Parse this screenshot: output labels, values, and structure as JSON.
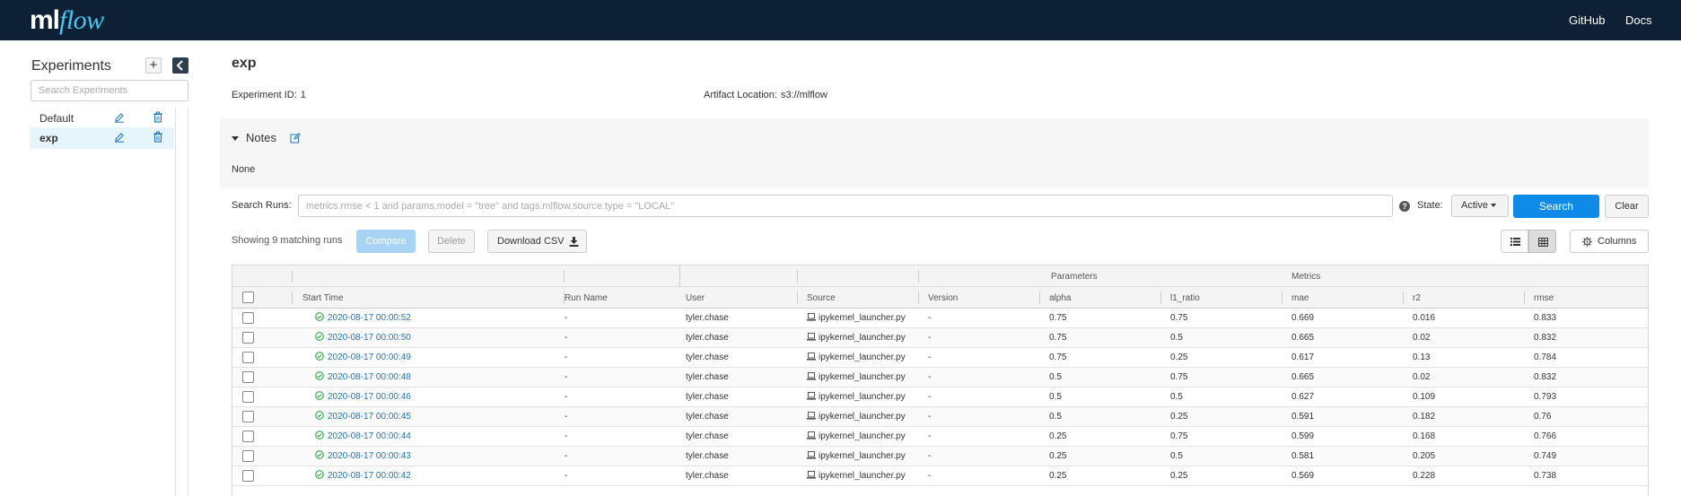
{
  "header": {
    "logo_ml": "ml",
    "logo_flow": "flow",
    "links": [
      "GitHub",
      "Docs"
    ]
  },
  "sidebar": {
    "title": "Experiments",
    "add_label": "+",
    "search_placeholder": "Search Experiments",
    "items": [
      {
        "label": "Default",
        "active": false
      },
      {
        "label": "exp",
        "active": true
      }
    ]
  },
  "experiment": {
    "name": "exp",
    "id_label": "Experiment ID:",
    "id_value": "1",
    "artifact_label": "Artifact Location:",
    "artifact_value": "s3://mlflow"
  },
  "notes": {
    "title": "Notes",
    "content": "None"
  },
  "search": {
    "label": "Search Runs:",
    "placeholder": "metrics.rmse < 1 and params.model = \"tree\" and tags.mlflow.source.type = \"LOCAL\"",
    "help": "?",
    "state_label": "State:",
    "state_value": "Active",
    "search_button": "Search",
    "clear_button": "Clear"
  },
  "toolbar": {
    "showing": "Showing 9 matching runs",
    "compare": "Compare",
    "delete": "Delete",
    "download_csv": "Download CSV",
    "columns": "Columns"
  },
  "table": {
    "group_headers": {
      "parameters": "Parameters",
      "metrics": "Metrics"
    },
    "columns": [
      "Start Time",
      "Run Name",
      "User",
      "Source",
      "Version",
      "alpha",
      "l1_ratio",
      "mae",
      "r2",
      "rmse"
    ],
    "rows": [
      {
        "start": "2020-08-17 00:00:52",
        "run_name": "-",
        "user": "tyler.chase",
        "source": "ipykernel_launcher.py",
        "version": "-",
        "alpha": "0.75",
        "l1_ratio": "0.75",
        "mae": "0.669",
        "r2": "0.016",
        "rmse": "0.833"
      },
      {
        "start": "2020-08-17 00:00:50",
        "run_name": "-",
        "user": "tyler.chase",
        "source": "ipykernel_launcher.py",
        "version": "-",
        "alpha": "0.75",
        "l1_ratio": "0.5",
        "mae": "0.665",
        "r2": "0.02",
        "rmse": "0.832"
      },
      {
        "start": "2020-08-17 00:00:49",
        "run_name": "-",
        "user": "tyler.chase",
        "source": "ipykernel_launcher.py",
        "version": "-",
        "alpha": "0.75",
        "l1_ratio": "0.25",
        "mae": "0.617",
        "r2": "0.13",
        "rmse": "0.784"
      },
      {
        "start": "2020-08-17 00:00:48",
        "run_name": "-",
        "user": "tyler.chase",
        "source": "ipykernel_launcher.py",
        "version": "-",
        "alpha": "0.5",
        "l1_ratio": "0.75",
        "mae": "0.665",
        "r2": "0.02",
        "rmse": "0.832"
      },
      {
        "start": "2020-08-17 00:00:46",
        "run_name": "-",
        "user": "tyler.chase",
        "source": "ipykernel_launcher.py",
        "version": "-",
        "alpha": "0.5",
        "l1_ratio": "0.5",
        "mae": "0.627",
        "r2": "0.109",
        "rmse": "0.793"
      },
      {
        "start": "2020-08-17 00:00:45",
        "run_name": "-",
        "user": "tyler.chase",
        "source": "ipykernel_launcher.py",
        "version": "-",
        "alpha": "0.5",
        "l1_ratio": "0.25",
        "mae": "0.591",
        "r2": "0.182",
        "rmse": "0.76"
      },
      {
        "start": "2020-08-17 00:00:44",
        "run_name": "-",
        "user": "tyler.chase",
        "source": "ipykernel_launcher.py",
        "version": "-",
        "alpha": "0.25",
        "l1_ratio": "0.75",
        "mae": "0.599",
        "r2": "0.168",
        "rmse": "0.766"
      },
      {
        "start": "2020-08-17 00:00:43",
        "run_name": "-",
        "user": "tyler.chase",
        "source": "ipykernel_launcher.py",
        "version": "-",
        "alpha": "0.25",
        "l1_ratio": "0.5",
        "mae": "0.581",
        "r2": "0.205",
        "rmse": "0.749"
      },
      {
        "start": "2020-08-17 00:00:42",
        "run_name": "-",
        "user": "tyler.chase",
        "source": "ipykernel_launcher.py",
        "version": "-",
        "alpha": "0.25",
        "l1_ratio": "0.25",
        "mae": "0.569",
        "r2": "0.228",
        "rmse": "0.738"
      }
    ]
  },
  "colors": {
    "topbar": "#0e2036",
    "brand_accent": "#43c9ed",
    "primary_button": "#0e8ae8",
    "link": "#2374bb",
    "success": "#2aa745"
  }
}
